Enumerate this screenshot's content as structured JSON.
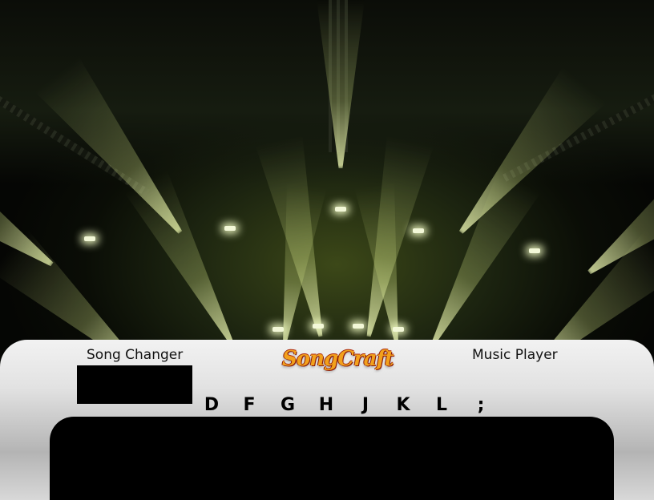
{
  "panel": {
    "left_label": "Song Changer",
    "right_label": "Music Player",
    "logo_text": "SongCraft"
  },
  "keys": [
    "D",
    "F",
    "G",
    "H",
    "J",
    "K",
    "L",
    ";"
  ],
  "colors": {
    "beam": "#e2ecaa",
    "panel": "#e2e2e2",
    "logo": "#f2a11c"
  }
}
